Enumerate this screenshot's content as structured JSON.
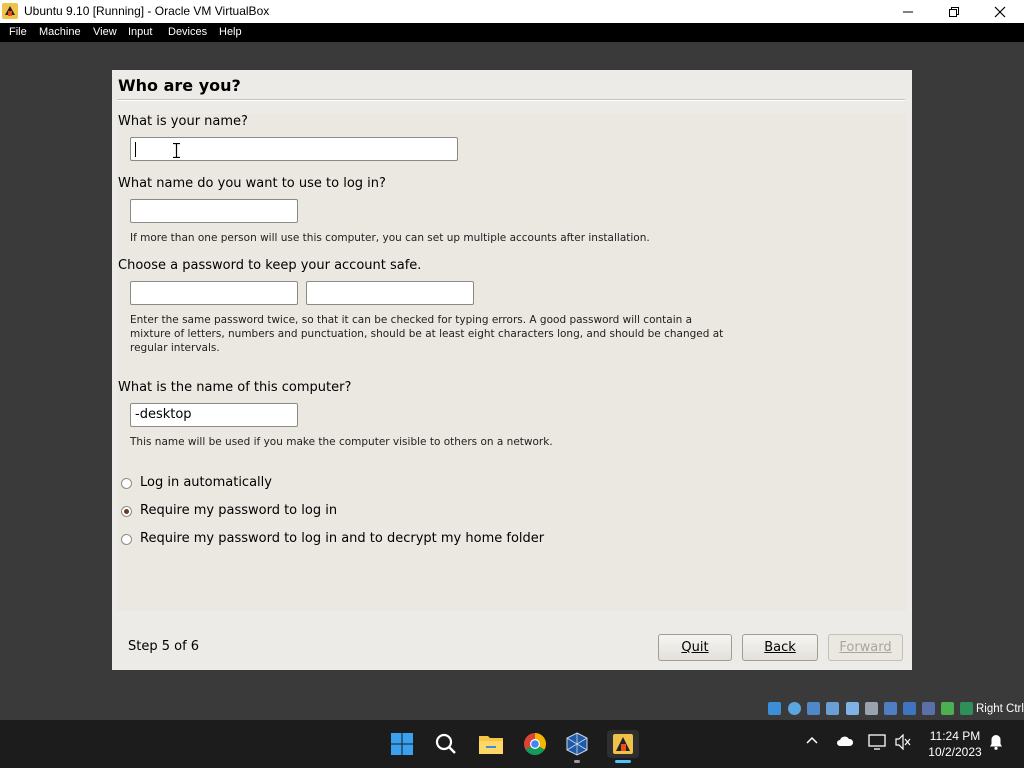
{
  "window": {
    "title": "Ubuntu 9.10 [Running] - Oracle VM VirtualBox"
  },
  "menu": [
    "File",
    "Machine",
    "View",
    "Input",
    "Devices",
    "Help"
  ],
  "dialog": {
    "title": "Who are you?",
    "name_question": "What is your name?",
    "name_value": "",
    "login_question": "What name do you want to use to log in?",
    "login_value": "",
    "login_hint": "If more than one person will use this computer, you can set up multiple accounts after installation.",
    "password_question": "Choose a password to keep your account safe.",
    "password_value": "",
    "password_confirm_value": "",
    "password_hint_line1": "Enter the same password twice, so that it can be checked for typing errors. A good password will contain a",
    "password_hint_line2": "mixture of letters, numbers and punctuation, should be at least eight characters long, and should be changed at",
    "password_hint_line3": "regular intervals.",
    "computer_question": "What is the name of this computer?",
    "computer_value": "-desktop",
    "computer_hint": "This name will be used if you make the computer visible to others on a network.",
    "login_options": [
      {
        "label": "Log in automatically",
        "selected": false
      },
      {
        "label": "Require my password to log in",
        "selected": true
      },
      {
        "label": "Require my password to log in and to decrypt my home folder",
        "selected": false
      }
    ],
    "step": "Step 5 of 6",
    "buttons": {
      "quit": "Quit",
      "back": "Back",
      "forward": "Forward"
    }
  },
  "statusbar": {
    "host_key": "Right Ctrl"
  },
  "taskbar": {
    "apps": [
      "windows-start-icon",
      "search-icon",
      "file-explorer-icon",
      "chrome-icon",
      "virtualbox-icon",
      "vm-window-icon"
    ],
    "time": "11:24 PM",
    "date": "10/2/2023"
  },
  "colors": {
    "dialog_bg": "#edebe7",
    "vm_bg": "#3a3a3a",
    "taskbar_bg": "#1c1c1c",
    "radio_selected": "#6b3a24"
  }
}
